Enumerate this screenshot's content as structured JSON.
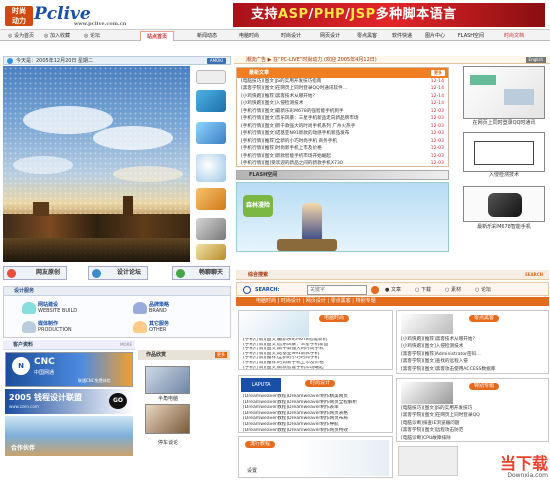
{
  "header": {
    "logo_line1": "时尚",
    "logo_line2": "动力",
    "brand": "Pclive",
    "brand_sub": "www.pclive.com.cn",
    "banner_pre": "支持",
    "banner_asp": "ASP",
    "banner_slash1": "/",
    "banner_php": "PHP",
    "banner_slash2": "/",
    "banner_jsp": "JSP",
    "banner_post": "多种脚本语言"
  },
  "topbar": {
    "links": [
      "设为首页",
      "加入收藏",
      "论坛"
    ],
    "tabs": [
      "站点首页",
      "新闻动态",
      "电脑时尚",
      "时尚设计",
      "网页设计",
      "零点黑客",
      "软件快递",
      "图片中心",
      "FLASH空间",
      "时尚文档"
    ],
    "active_tab": "站点首页"
  },
  "date_bar": {
    "text": "今天是：2005年12月20日 星期二",
    "badge": "AMOKI"
  },
  "action_buttons": [
    "网友原创",
    "设计论坛",
    "畅聊聊天"
  ],
  "design_service": {
    "title": "设计服务",
    "items": [
      {
        "name": "网站建设",
        "en": "WEBSITE BUILD"
      },
      {
        "name": "品牌策略",
        "en": "BRAND"
      },
      {
        "name": "媒体制作",
        "en": "PRODUCTION"
      },
      {
        "name": "其它服务",
        "en": "OTHER"
      }
    ]
  },
  "client_section": {
    "title": "客户资料",
    "more": "MORE"
  },
  "ads": [
    {
      "brand": "CNC",
      "sub": "中国网通",
      "note": "联通CNC免费体验"
    },
    {
      "brand": "2005 钱程设计联盟",
      "sub": "www.zzen.com"
    },
    {
      "brand": "合作伙伴"
    }
  ],
  "sample_works": {
    "title": "作品欣赏",
    "more": "更多",
    "caption": "半角电脑",
    "caption2": "停车谈论"
  },
  "right_header": {
    "text": "潮流广告 ▶ 在“PC-LIVE”时尚动力  (欢迎  2005年4月12日)",
    "badge": "English"
  },
  "latest_news": {
    "title": "最新文章",
    "more": "更多",
    "items": [
      {
        "t": "[电脑技巧][图文]JS的实用开发技巧指南",
        "d": "12-14"
      },
      {
        "t": "[黑客学院][图文]在网页上同时登录QQ时通讯软件…",
        "d": "12-14"
      },
      {
        "t": "[小鸡快跑][推荐]黑客技术从哪开始？",
        "d": "12-14"
      },
      {
        "t": "[小鸡快跑][图文]入侵检测技术",
        "d": "12-14"
      },
      {
        "t": "[手机行情][图文]最新乐彩M678的强智能手机到手",
        "d": "12-03"
      },
      {
        "t": "[手机行情][图文]音乐风暴：三星手机新品走向新品牌市场",
        "d": "12-03"
      },
      {
        "t": "[手机行情][图文]新千款强大的时尚手机系列  广州火热手",
        "d": "12-03"
      },
      {
        "t": "[手机行情][图文]诺基亚N91新款的动感手机新品发布",
        "d": "12-03"
      },
      {
        "t": "[手机行情][推荐]全新的小巧时尚手机  商务手机",
        "d": "12-03"
      },
      {
        "t": "[手机行情][推荐]时尚新手机上市及价格",
        "d": "12-03"
      },
      {
        "t": "[手机行情][图文]新款智能手机市场开始崛起",
        "d": "12-03"
      },
      {
        "t": "[手机行情][图]受欢迎的新品之间的新款手机X730",
        "d": "12-03"
      }
    ]
  },
  "right_thumbs": [
    {
      "caption": "在网页上同时登录QQ时通讯"
    },
    {
      "caption": "入侵检测技术"
    },
    {
      "caption": "最新乐彩M678智能手机"
    }
  ],
  "flash_section": {
    "title": "FLASH空间",
    "game_title": "森林漫险"
  },
  "search": {
    "title": "综合搜索",
    "badge": "SEARCH",
    "label": "SEARCH:",
    "placeholder": "关键字",
    "options": [
      "文章",
      "下载",
      "素材",
      "论坛"
    ],
    "selected": "文章"
  },
  "nav_row": [
    "电脑时尚",
    "时尚设计",
    "网页设计",
    "零点黑客",
    "特别专题"
  ],
  "pane_heads": [
    "电脑时尚",
    "零点黑客",
    "时尚设计",
    "特别专题",
    "网页设计",
    "流行教程"
  ],
  "pane_more": "MORE",
  "mid_news": [
    "[手机行情][图文]最新乐彩M678智能新机",
    "[手机行情][图文]音乐风暴：三星手机新品",
    "[手机行情][图文]新千款强大的时尚手机",
    "[手机行情][图文]诺基亚N91新款手机",
    "[手机行情][推荐]全新的小巧时尚手机",
    "[手机行情][推荐]时尚新手机上市及价格",
    "[手机行情][图文]新款智能手机市场崛起"
  ],
  "right_news": [
    "[小鸡快跑][推荐]黑客技术从哪开始？",
    "[小鸡快跑][图文]入侵检测技术",
    "[黑客学院][推荐]Administrator密码…",
    "[黑客学院][图文]查找的远程入侵",
    "[黑客学院][图文]黑客攻击使用ACCESS数据库"
  ],
  "bottom_left_news": [
    "[Dreamweaver教程]Dreamweaver制作精美网页",
    "[Dreamweaver教程]Dreamweaver制作网页全程解析",
    "[Dreamweaver教程]Dreamweaver制作表单",
    "[Dreamweaver教程]Dreamweaver制作网页表格",
    "[Dreamweaver教程]Dreamweaver制作网页布局",
    "[Dreamweaver教程]Dreamweaver制作导航",
    "[Dreamweaver教程]Dreamweaver制作网页特效"
  ],
  "bottom_right_news": [
    "[电脑技巧][图文]JS的实用开发技巧",
    "[黑客学院][图文]在网页上同时登录QQ",
    "[电脑诊断]排查IE浏览器问题",
    "[黑客学院][图文]远程攻击防范",
    "[电脑诊断]CPU故障排除"
  ],
  "bottom_left_misc": [
    "流行教程",
    "最新",
    "设置"
  ],
  "watermark": {
    "brand": "当下载",
    "url": "Downxia.com"
  }
}
